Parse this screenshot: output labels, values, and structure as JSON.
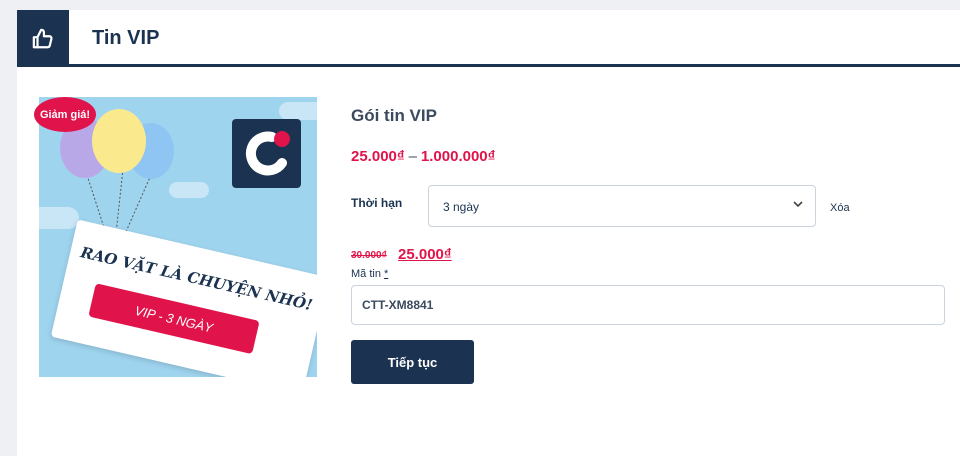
{
  "header": {
    "title": "Tin VIP",
    "icon": "thumbs-up-icon"
  },
  "promo": {
    "badge": "Giảm giá!",
    "headline": "RAO VẶT LÀ CHUYỆN NHỎ!",
    "package_label": "VIP - 3 NGÀY"
  },
  "product": {
    "name": "Gói tin VIP",
    "price_min": "25.000₫",
    "price_separator": "–",
    "price_max": "1.000.000₫"
  },
  "duration": {
    "label": "Thời hạn",
    "selected": "3 ngày",
    "clear_label": "Xóa"
  },
  "pricing": {
    "old_price": "30.000₫",
    "new_price": "25.000₫"
  },
  "code": {
    "label": "Mã tin",
    "required_mark": "*",
    "value": "CTT-XM8841"
  },
  "actions": {
    "continue_label": "Tiếp tục"
  },
  "colors": {
    "primary": "#1b3350",
    "accent": "#e0134a",
    "promo_bg": "#9fd4ef"
  }
}
